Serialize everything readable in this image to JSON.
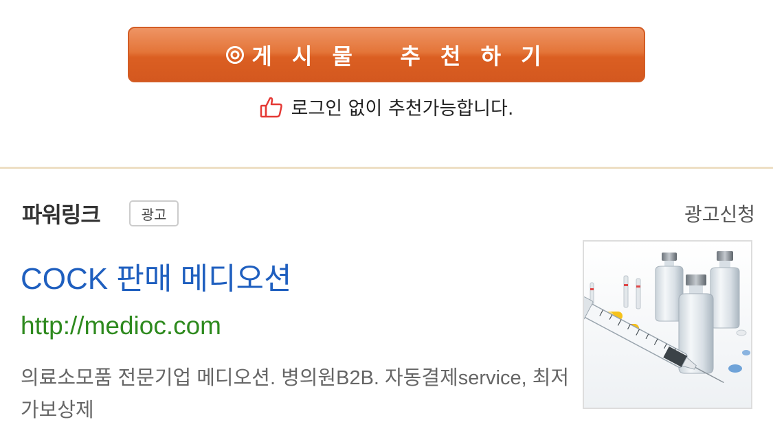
{
  "recommend": {
    "button_label": "게 시 물   추 천 하 기",
    "note": "로그인 없이 추천가능합니다."
  },
  "powerlink": {
    "title": "파워링크",
    "badge": "광고",
    "apply_link": "광고신청"
  },
  "ad": {
    "title": "COCK 판매 메디오션",
    "url": "http://medioc.com",
    "description": "의료소모품 전문기업 메디오션. 병의원B2B. 자동결제service, 최저가보상제",
    "thumbnail_icon": "medical-vials-syringe-image"
  },
  "colors": {
    "button_orange": "#e06a2c",
    "ad_title_blue": "#1f5fbf",
    "ad_url_green": "#2e8a1e",
    "thumb_red": "#e53935",
    "divider": "#eedfc4"
  }
}
